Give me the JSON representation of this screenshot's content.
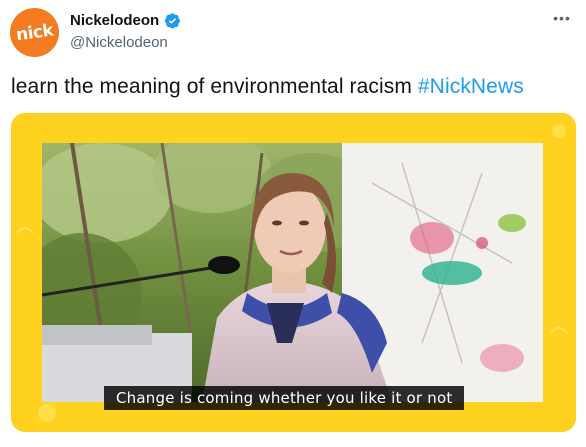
{
  "tweet": {
    "author": {
      "avatar_text": "nick",
      "display_name": "Nickelodeon",
      "handle": "@Nickelodeon",
      "verified_icon": "verified-badge-icon"
    },
    "more_icon": "more-options-icon",
    "text": "learn the meaning of environmental racism ",
    "hashtag": "#NickNews",
    "media": {
      "caption": "Change is coming whether you like it or not"
    }
  },
  "colors": {
    "brand_orange": "#f47b20",
    "frame_yellow": "#ffd21f",
    "link_blue": "#1d9bf0",
    "text_primary": "#0f1419",
    "text_secondary": "#536471"
  }
}
